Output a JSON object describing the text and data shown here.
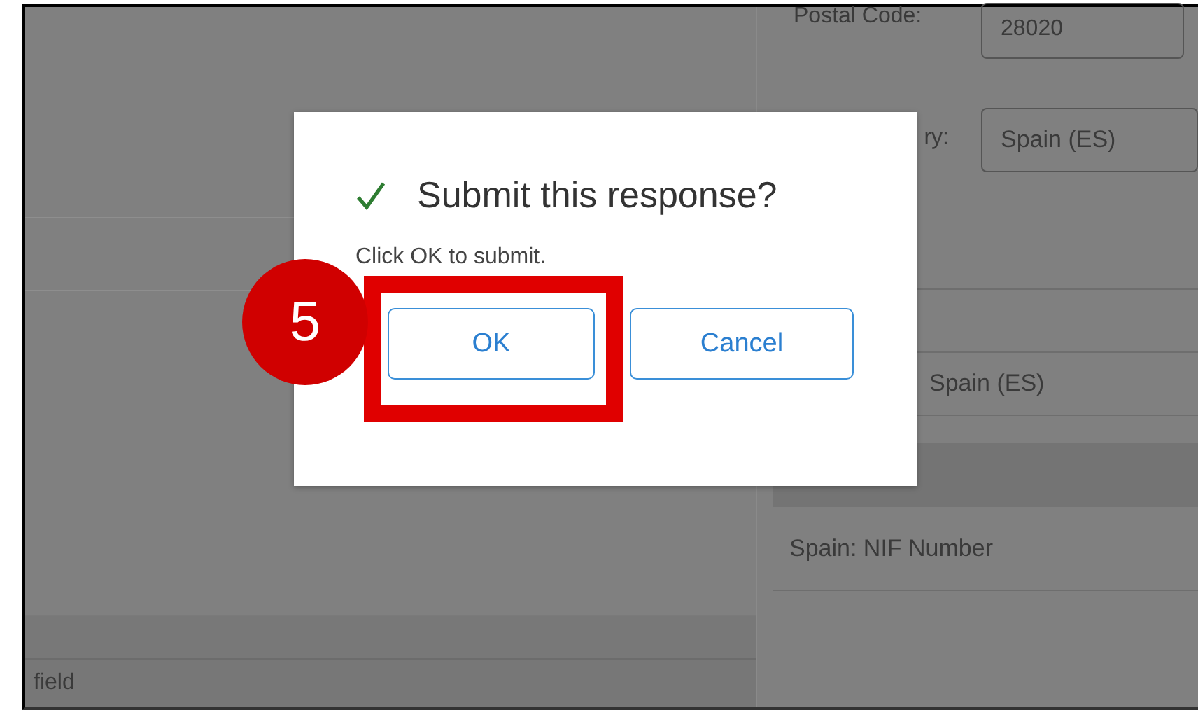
{
  "form": {
    "postal_code": {
      "label": "Postal Code:",
      "value": "28020"
    },
    "country": {
      "label": "ry:",
      "value": "Spain (ES)"
    },
    "country_display": "Spain (ES)",
    "table": {
      "rows": [
        {
          "column_1": "Spain: NIF Number"
        }
      ]
    },
    "footer_text": "field"
  },
  "dialog": {
    "title": "Submit this response?",
    "message": "Click OK to submit.",
    "buttons": [
      {
        "label": "OK",
        "highlighted": true
      },
      {
        "label": "Cancel",
        "highlighted": false
      }
    ]
  },
  "callout": {
    "number": "5"
  }
}
